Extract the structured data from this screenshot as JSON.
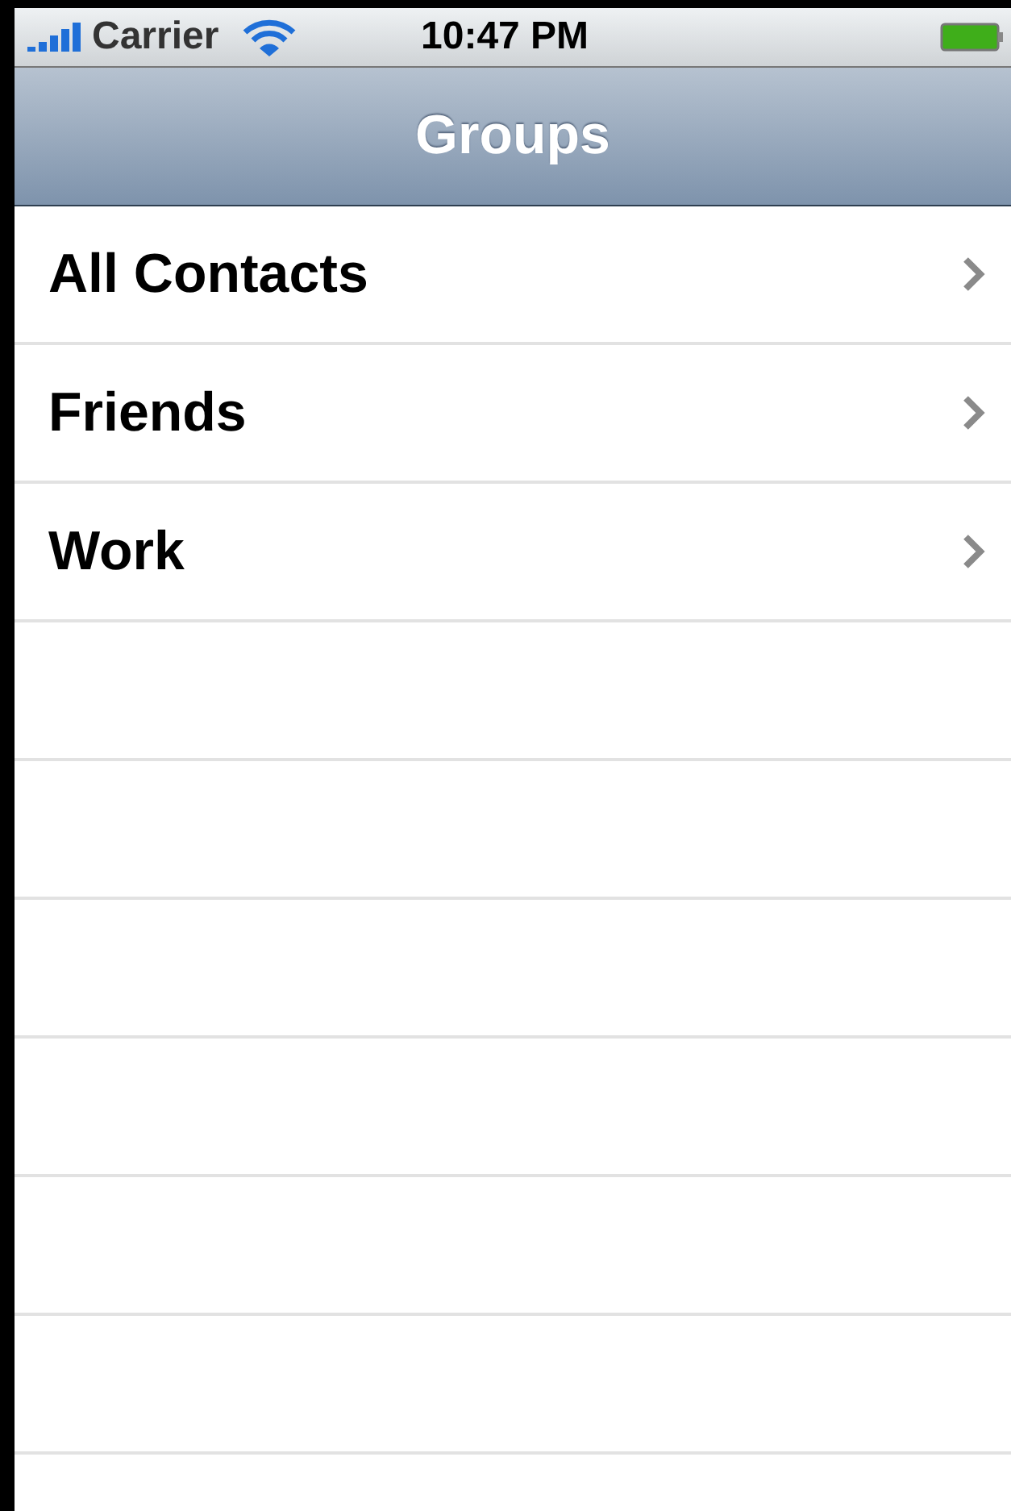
{
  "status_bar": {
    "carrier": "Carrier",
    "time": "10:47 PM"
  },
  "nav_bar": {
    "title": "Groups"
  },
  "groups": [
    {
      "label": "All Contacts"
    },
    {
      "label": "Friends"
    },
    {
      "label": "Work"
    }
  ]
}
